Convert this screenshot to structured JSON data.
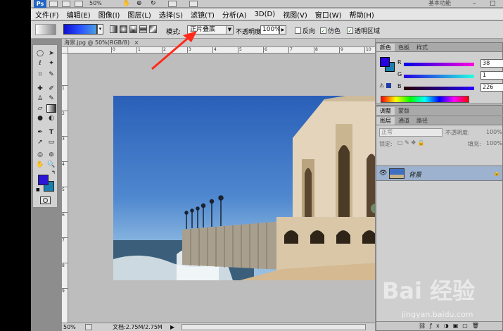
{
  "titlebar": {
    "zoom": "50%",
    "workspace": "基本功能",
    "controls": [
      "–",
      "□"
    ]
  },
  "menu": [
    "文件(F)",
    "编辑(E)",
    "图像(I)",
    "图层(L)",
    "选择(S)",
    "滤镜(T)",
    "分析(A)",
    "3D(D)",
    "视图(V)",
    "窗口(W)",
    "帮助(H)"
  ],
  "options": {
    "mode_label": "模式:",
    "mode_value": "正片叠底",
    "opacity_label": "不透明度:",
    "opacity_value": "100%",
    "reverse_label": "反向",
    "dither_label": "仿色",
    "transparency_label": "透明区域",
    "reverse_checked": false,
    "dither_checked": true,
    "transparency_checked": true
  },
  "document": {
    "tab_title": "海景.jpg @ 50%(RGB/8)",
    "ruler_h": [
      "0",
      "1",
      "2",
      "3",
      "4",
      "5",
      "6",
      "7",
      "8",
      "9",
      "10"
    ],
    "ruler_v": [
      "1",
      "2",
      "3",
      "4",
      "5",
      "6",
      "7",
      "8",
      "9"
    ],
    "status_zoom": "50%",
    "status_doc": "文档:2.75M/2.75M"
  },
  "color_panel": {
    "tabs": [
      "颜色",
      "色板",
      "样式"
    ],
    "r_label": "R",
    "g_label": "G",
    "b_label": "B",
    "r_value": "38",
    "g_value": "1",
    "b_value": "226",
    "fg_color": "#2601e2"
  },
  "adjust_panel": {
    "tabs": [
      "调整",
      "蒙版"
    ]
  },
  "layers_panel": {
    "tabs": [
      "图层",
      "通道",
      "路径"
    ],
    "blend_mode": "正常",
    "opacity_label": "不透明度:",
    "opacity_value": "100%",
    "lock_label": "锁定:",
    "fill_label": "填充:",
    "fill_value": "100%",
    "layer_name": "背景"
  },
  "watermark": {
    "text": "Bai 经验",
    "url": "jingyan.baidu.com"
  }
}
